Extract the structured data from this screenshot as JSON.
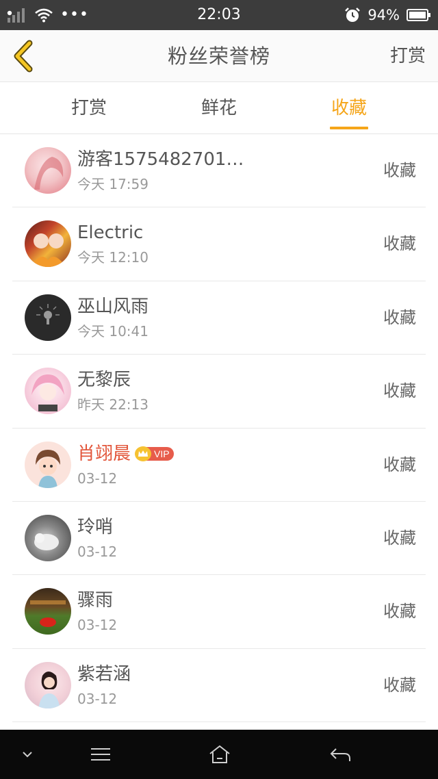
{
  "status_bar": {
    "time": "22:03",
    "battery": "94%",
    "icons": [
      "signal-icon",
      "wifi-icon",
      "more-dots-icon",
      "alarm-icon",
      "battery-icon"
    ],
    "dots": "•••"
  },
  "header": {
    "title": "粉丝荣誉榜",
    "right_button": "打赏"
  },
  "tabs": [
    {
      "label": "打赏",
      "active": false
    },
    {
      "label": "鲜花",
      "active": false
    },
    {
      "label": "收藏",
      "active": true
    }
  ],
  "accent_color": "#f5a519",
  "list": [
    {
      "name": "游客1575482701…",
      "time": "今天 17:59",
      "action": "收藏",
      "vip": false
    },
    {
      "name": "Electric",
      "time": "今天 12:10",
      "action": "收藏",
      "vip": false
    },
    {
      "name": "巫山风雨",
      "time": "今天 10:41",
      "action": "收藏",
      "vip": false
    },
    {
      "name": "无黎辰",
      "time": "昨天 22:13",
      "action": "收藏",
      "vip": false
    },
    {
      "name": "肖翊晨",
      "time": "03-12",
      "action": "收藏",
      "vip": true,
      "badge": "VIP"
    },
    {
      "name": "玲哨",
      "time": "03-12",
      "action": "收藏",
      "vip": false
    },
    {
      "name": "骤雨",
      "time": "03-12",
      "action": "收藏",
      "vip": false
    },
    {
      "name": "紫若涵",
      "time": "03-12",
      "action": "收藏",
      "vip": false
    }
  ],
  "nav_bar": {
    "icons": [
      "chevron-down-icon",
      "menu-icon",
      "home-icon",
      "back-arrow-icon"
    ]
  }
}
